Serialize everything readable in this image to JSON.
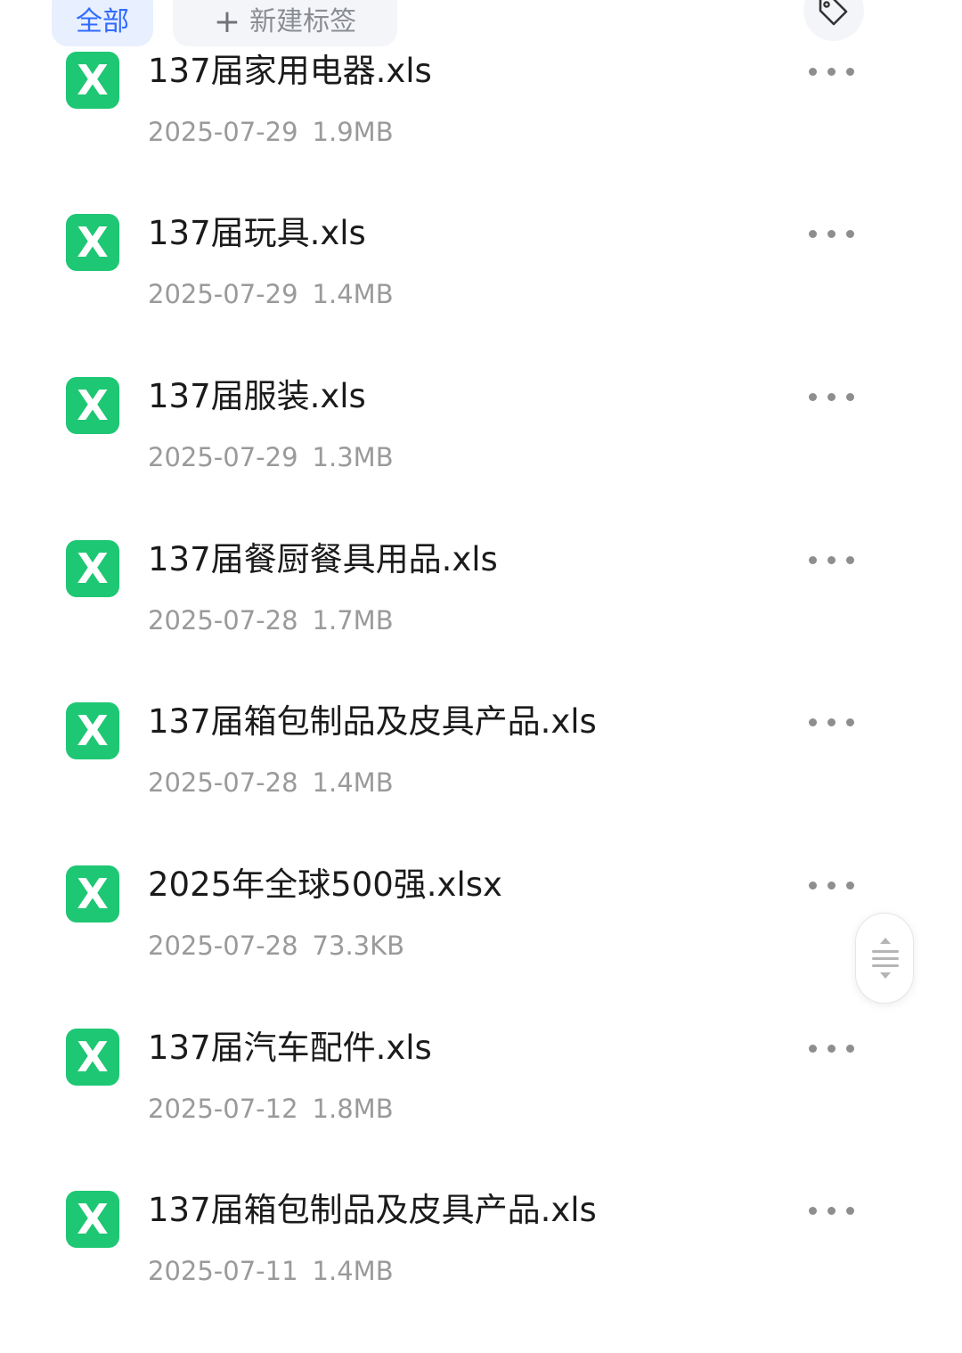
{
  "tag_bar": {
    "all_label": "全部",
    "new_tag_label": "新建标签",
    "new_tag_icon": "plus-icon",
    "manage_icon": "tag-icon"
  },
  "files": [
    {
      "name": "137届家用电器.xls",
      "date": "2025-07-29",
      "size": "1.9MB",
      "icon": "excel-icon"
    },
    {
      "name": "137届玩具.xls",
      "date": "2025-07-29",
      "size": "1.4MB",
      "icon": "excel-icon"
    },
    {
      "name": "137届服装.xls",
      "date": "2025-07-29",
      "size": "1.3MB",
      "icon": "excel-icon"
    },
    {
      "name": "137届餐厨餐具用品.xls",
      "date": "2025-07-28",
      "size": "1.7MB",
      "icon": "excel-icon"
    },
    {
      "name": "137届箱包制品及皮具产品.xls",
      "date": "2025-07-28",
      "size": "1.4MB",
      "icon": "excel-icon"
    },
    {
      "name": "2025年全球500强.xlsx",
      "date": "2025-07-28",
      "size": "73.3KB",
      "icon": "excel-icon"
    },
    {
      "name": "137届汽车配件.xls",
      "date": "2025-07-12",
      "size": "1.8MB",
      "icon": "excel-icon"
    },
    {
      "name": "137届箱包制品及皮具产品.xls",
      "date": "2025-07-11",
      "size": "1.4MB",
      "icon": "excel-icon"
    }
  ],
  "icon_letter": "X",
  "colors": {
    "accent": "#2f6bff",
    "excel_green": "#1ec773",
    "meta_gray": "#9a9a9a"
  },
  "scroll_handle_icon": "scroll-handle-icon"
}
